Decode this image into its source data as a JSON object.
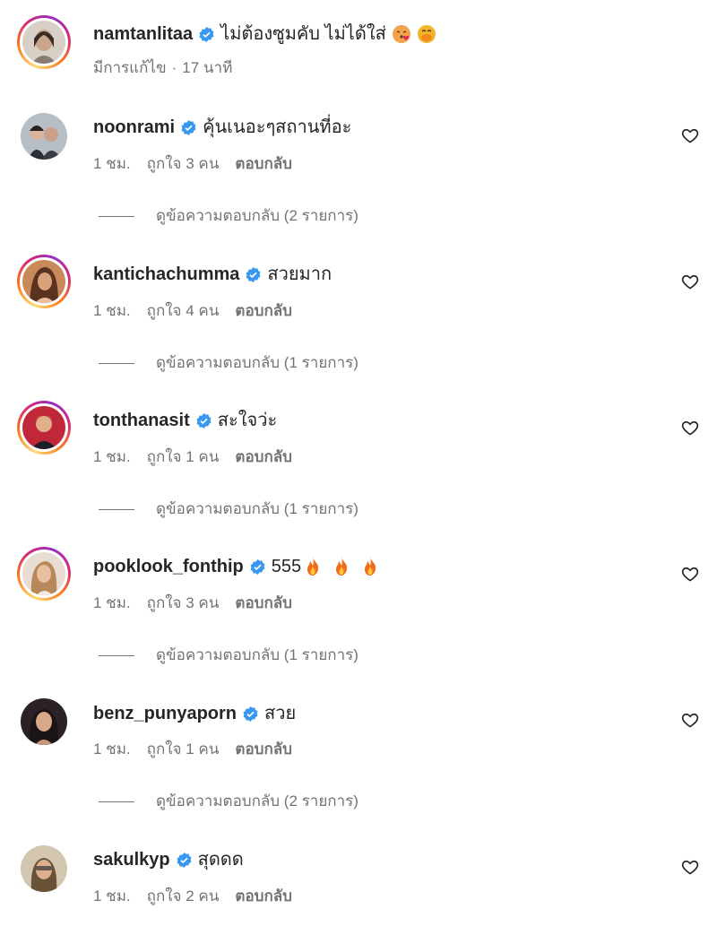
{
  "post": {
    "username": "namtanlitaa",
    "caption": "ไม่ต้องซูมคับ ไม่ได้ใส่",
    "caption_emojis": [
      "face-blowing-kiss-emoji",
      "face-hand-over-mouth-emoji"
    ],
    "edited_label": "มีการแก้ไข",
    "time": "17 นาที"
  },
  "comments": [
    {
      "username": "noonrami",
      "text": "คุ้นเนอะๆสถานที่อะ",
      "time": "1 ชม.",
      "likes": "ถูกใจ 3 คน",
      "reply_label": "ตอบกลับ",
      "view_replies": "ดูข้อความตอบกลับ (2 รายการ)"
    },
    {
      "username": "kantichachumma",
      "text": "สวยมาก",
      "time": "1 ชม.",
      "likes": "ถูกใจ 4 คน",
      "reply_label": "ตอบกลับ",
      "view_replies": "ดูข้อความตอบกลับ (1 รายการ)"
    },
    {
      "username": "tonthanasit",
      "text": "สะใจว่ะ",
      "time": "1 ชม.",
      "likes": "ถูกใจ 1 คน",
      "reply_label": "ตอบกลับ",
      "view_replies": "ดูข้อความตอบกลับ (1 รายการ)"
    },
    {
      "username": "pooklook_fonthip",
      "text": "555",
      "text_emojis": [
        "fire-emoji",
        "fire-emoji",
        "fire-emoji"
      ],
      "time": "1 ชม.",
      "likes": "ถูกใจ 3 คน",
      "reply_label": "ตอบกลับ",
      "view_replies": "ดูข้อความตอบกลับ (1 รายการ)"
    },
    {
      "username": "benz_punyaporn",
      "text": "สวย",
      "time": "1 ชม.",
      "likes": "ถูกใจ 1 คน",
      "reply_label": "ตอบกลับ",
      "view_replies": "ดูข้อความตอบกลับ (2 รายการ)"
    },
    {
      "username": "sakulkyp",
      "text": "สุดดด",
      "time": "1 ชม.",
      "likes": "ถูกใจ 2 คน",
      "reply_label": "ตอบกลับ"
    }
  ],
  "colors": {
    "verified_blue": "#3897f0",
    "text_primary": "#262626",
    "text_secondary": "#737373"
  }
}
